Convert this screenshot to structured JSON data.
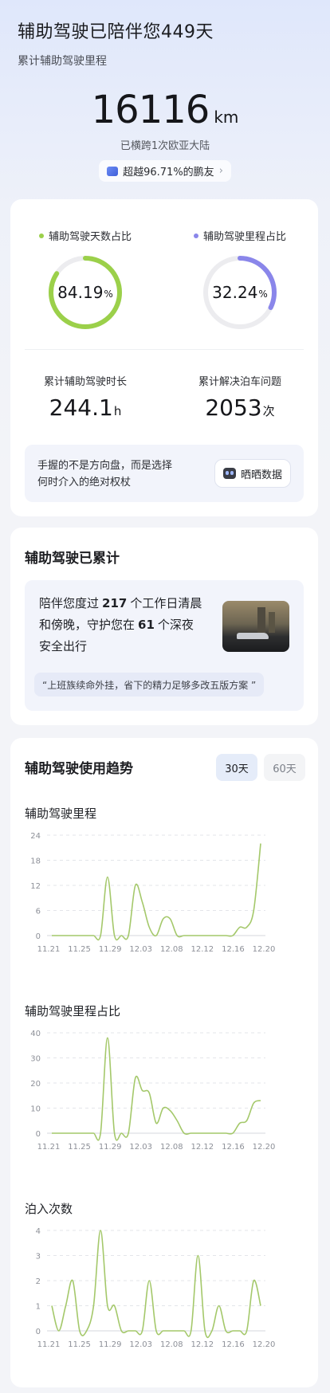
{
  "header": {
    "title": "辅助驾驶已陪伴您449天",
    "subtitle": "累计辅助驾驶里程"
  },
  "total": {
    "value": "16116",
    "unit": "km",
    "desc": "已横跨1次欧亚大陆",
    "beat": "超越96.71%的鹏友"
  },
  "summary": {
    "days_ratio": {
      "label": "辅助驾驶天数占比",
      "value": "84.19",
      "unit": "%",
      "fraction": 0.8419,
      "color": "#9bd04a"
    },
    "mileage_ratio": {
      "label": "辅助驾驶里程占比",
      "value": "32.24",
      "unit": "%",
      "fraction": 0.3224,
      "color": "#8a86ea"
    },
    "duration": {
      "label": "累计辅助驾驶时长",
      "value": "244.1",
      "unit": "h"
    },
    "parking": {
      "label": "累计解决泊车问题",
      "value": "2053",
      "unit": "次"
    },
    "share_text_1": "手握的不是方向盘，而是选择",
    "share_text_2": "何时介入的绝对权杖",
    "share_button": "晒晒数据"
  },
  "accumulated": {
    "title": "辅助驾驶已累计",
    "line1_a": "陪伴您度过",
    "line1_num": "217",
    "line1_b": "个工作日清晨",
    "line2_a": "和傍晚，守护您在",
    "line2_num": "61",
    "line2_b": "个深夜",
    "line3": "安全出行",
    "quote": "“上班族续命外挂，省下的精力足够多改五版方案 ”"
  },
  "trend": {
    "title": "辅助驾驶使用趋势",
    "tab_active": "30天",
    "tab_inactive": "60天",
    "line_color": "#a4c86a"
  },
  "chart_data": [
    {
      "type": "line",
      "title": "辅助驾驶里程",
      "x_ticks": [
        "11.21",
        "11.25",
        "11.29",
        "12.03",
        "12.08",
        "12.12",
        "12.16",
        "12.20"
      ],
      "y_ticks": [
        0,
        6,
        12,
        18,
        24
      ],
      "ylim": [
        0,
        24
      ],
      "grid": true,
      "series": [
        {
          "values": [
            0,
            0,
            0,
            0,
            0,
            0,
            0,
            0,
            14,
            0,
            0,
            0,
            12,
            8,
            2,
            0,
            4,
            4,
            0,
            0,
            0,
            0,
            0,
            0,
            0,
            0,
            0,
            2,
            2,
            6,
            22
          ]
        }
      ]
    },
    {
      "type": "line",
      "title": "辅助驾驶里程占比",
      "x_ticks": [
        "11.21",
        "11.25",
        "11.29",
        "12.03",
        "12.08",
        "12.12",
        "12.16",
        "12.20"
      ],
      "y_ticks": [
        0,
        10,
        20,
        30,
        40
      ],
      "ylim": [
        0,
        40
      ],
      "grid": true,
      "series": [
        {
          "values": [
            0,
            0,
            0,
            0,
            0,
            0,
            0,
            0,
            38,
            0,
            0,
            0,
            22,
            17,
            16,
            4,
            10,
            9,
            5,
            0,
            0,
            0,
            0,
            0,
            0,
            0,
            0,
            4,
            5,
            12,
            13
          ]
        }
      ]
    },
    {
      "type": "line",
      "title": "泊入次数",
      "x_ticks": [
        "11.21",
        "11.25",
        "11.29",
        "12.03",
        "12.08",
        "12.12",
        "12.16",
        "12.20"
      ],
      "y_ticks": [
        0,
        1,
        2,
        3,
        4
      ],
      "ylim": [
        0,
        4
      ],
      "grid": true,
      "series": [
        {
          "values": [
            1,
            0,
            1,
            2,
            0,
            0,
            1,
            4,
            1,
            1,
            0,
            0,
            0,
            0,
            2,
            0,
            0,
            0,
            0,
            0,
            0,
            3,
            0,
            0,
            1,
            0,
            0,
            0,
            0,
            2,
            1
          ]
        }
      ]
    }
  ]
}
